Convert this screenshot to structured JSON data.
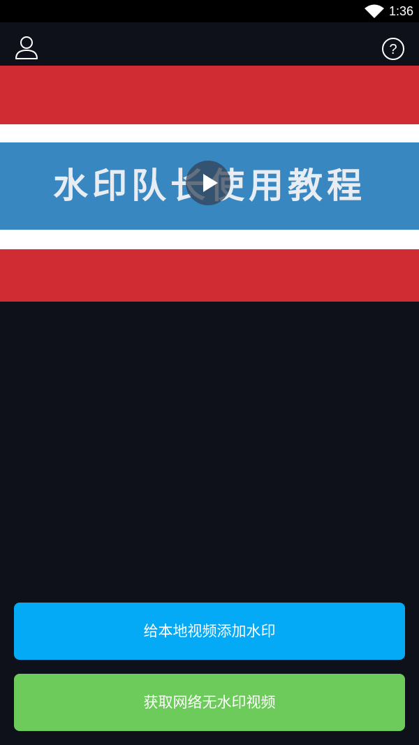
{
  "status_bar": {
    "time": "1:36",
    "wifi_icon": "wifi-icon"
  },
  "app_bar": {
    "user_icon": "user-icon",
    "help_icon": "help-icon"
  },
  "banner": {
    "title": "水印队长使用教程",
    "play_icon": "play-icon",
    "colors": {
      "red": "#d02c33",
      "white": "#ffffff",
      "blue": "#3887c1"
    }
  },
  "actions": {
    "add_watermark_label": "给本地视频添加水印",
    "remove_watermark_label": "获取网络无水印视频",
    "add_color": "#04aaf5",
    "remove_color": "#6ccb5a"
  }
}
